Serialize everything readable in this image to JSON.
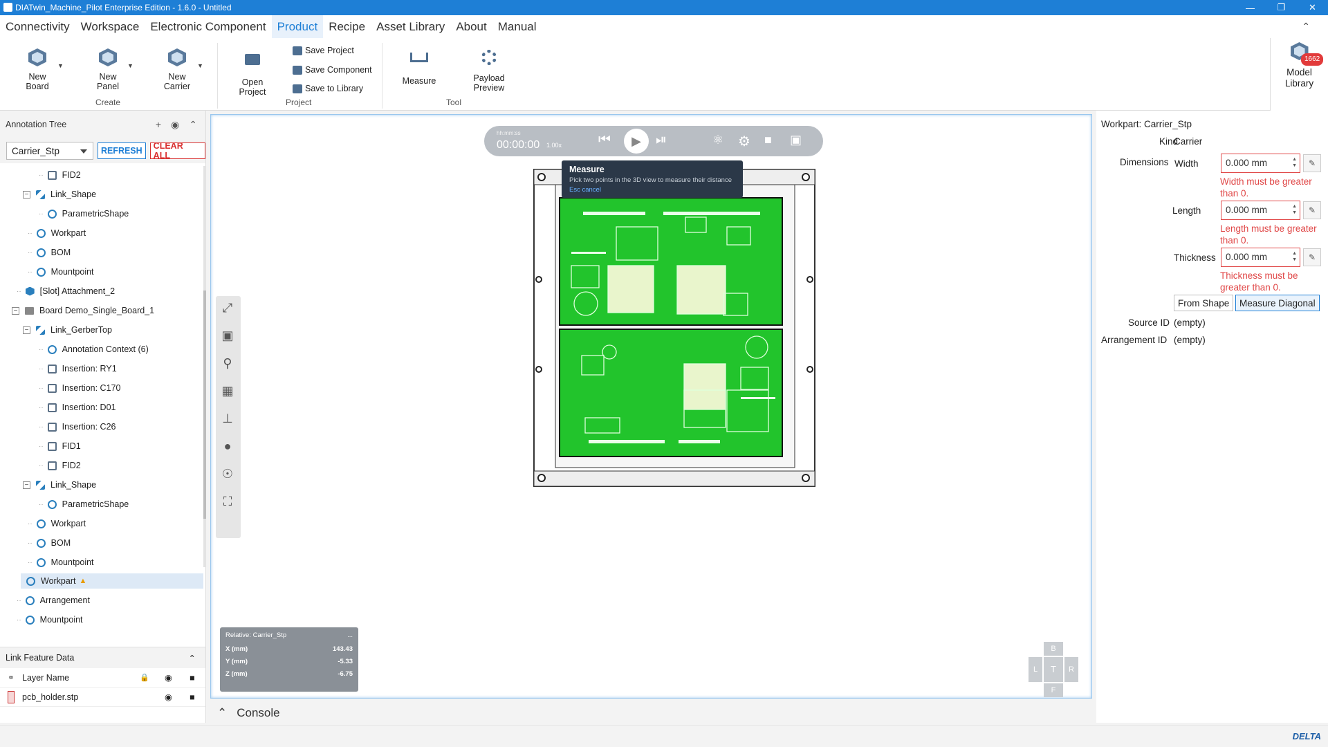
{
  "window": {
    "title": "DIATwin_Machine_Pilot Enterprise Edition - 1.6.0 - Untitled"
  },
  "menu": [
    "Connectivity",
    "Workspace",
    "Electronic Component",
    "Product",
    "Recipe",
    "Asset Library",
    "About",
    "Manual"
  ],
  "ribbon": {
    "new_board": "New Board",
    "new_panel": "New Panel",
    "new_carrier": "New Carrier",
    "create_group": "Create",
    "open_project": "Open Project",
    "save_project": "Save Project",
    "save_component": "Save Component",
    "save_library": "Save to Library",
    "project_group": "Project",
    "measure": "Measure",
    "payload_preview": "Payload Preview",
    "tool_group": "Tool",
    "model_library": "Model Library",
    "model_library_badge": "1662"
  },
  "annotation_tree": {
    "title": "Annotation Tree",
    "selected": "Carrier_Stp",
    "refresh": "REFRESH",
    "clear_all": "CLEAR ALL",
    "nodes": [
      "FID2",
      "Link_Shape",
      "ParametricShape",
      "Workpart",
      "BOM",
      "Mountpoint",
      "[Slot] Attachment_2",
      "Board  Demo_Single_Board_1",
      "Link_GerberTop",
      "Annotation Context (6)",
      "Insertion: RY1",
      "Insertion: C170",
      "Insertion: D01",
      "Insertion: C26",
      "FID1",
      "FID2",
      "Link_Shape",
      "ParametricShape",
      "Workpart",
      "BOM",
      "Mountpoint",
      "Workpart",
      "Arrangement",
      "Mountpoint"
    ]
  },
  "link_feature": {
    "title": "Link Feature Data",
    "col_layer": "Layer Name",
    "row_file": "pcb_holder.stp"
  },
  "player": {
    "time_label": "hh:mm:ss",
    "time": "00:00:00",
    "speed": "1.00x"
  },
  "tooltip": {
    "title": "Measure",
    "desc": "Pick two points in the 3D view to measure their distance",
    "esc": "Esc cancel"
  },
  "coords": {
    "relative": "Relative: Carrier_Stp",
    "menu": "...",
    "x_label": "X (mm)",
    "x": "143.43",
    "y_label": "Y (mm)",
    "y": "-5.33",
    "z_label": "Z (mm)",
    "z": "-6.75"
  },
  "navcube": {
    "b": "B",
    "l": "L",
    "t": "T",
    "r": "R",
    "f": "F"
  },
  "console": "Console",
  "properties": {
    "workpart": "Workpart: Carrier_Stp",
    "kind_label": "Kind",
    "kind": "Carrier",
    "dimensions": "Dimensions",
    "width_label": "Width",
    "width": "0.000 mm",
    "width_err": "Width must be greater than 0.",
    "length_label": "Length",
    "length": "0.000 mm",
    "length_err": "Length must be greater than 0.",
    "thickness_label": "Thickness",
    "thickness": "0.000 mm",
    "thickness_err": "Thickness must be greater than 0.",
    "from_shape": "From Shape",
    "measure_diagonal": "Measure Diagonal",
    "source_label": "Source ID",
    "source": "(empty)",
    "arrangement_label": "Arrangement ID",
    "arrangement": "(empty)"
  },
  "brand": "DELTA",
  "colors": {
    "accent": "#1e7fd6",
    "error": "#e04747",
    "pcb": "#22c42c"
  }
}
